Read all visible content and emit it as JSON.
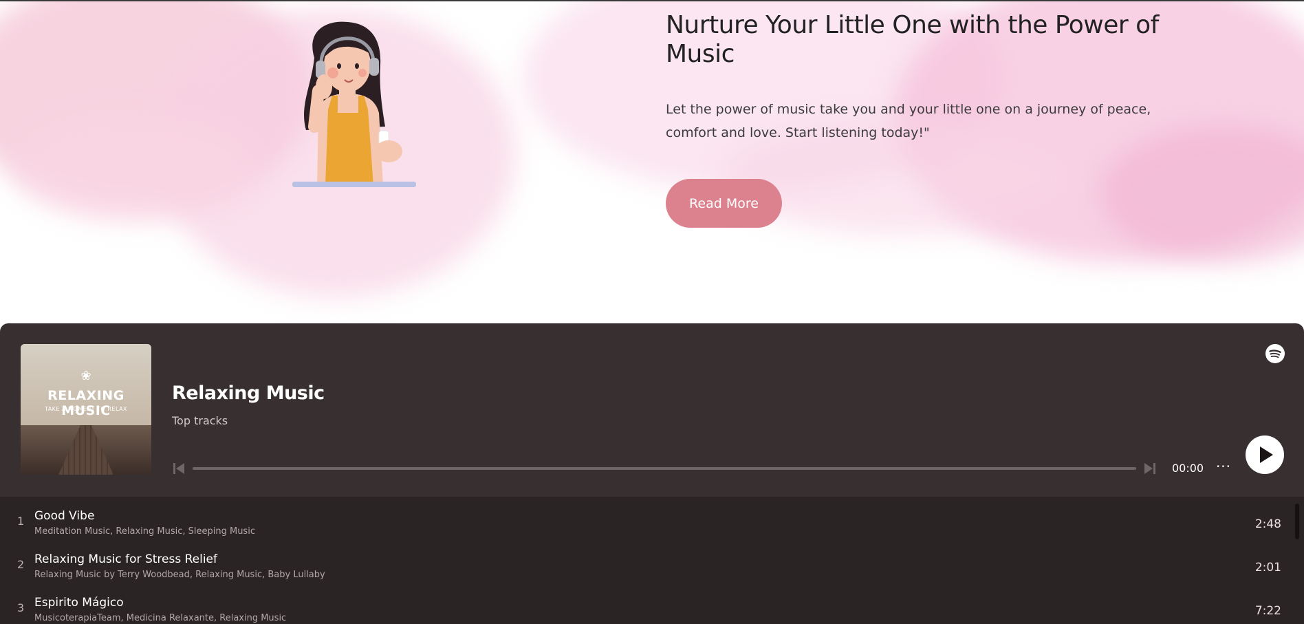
{
  "hero": {
    "title": "Nurture Your Little One with the Power of Music",
    "text": "Let the power of music take you and your little one on a journey of peace, comfort and love. Start listening today!\"",
    "button_label": "Read More"
  },
  "player": {
    "cover": {
      "title": "RELAXING MUSIC",
      "subtitle": "TAKE A MOMENT TO RELAX"
    },
    "title": "Relaxing Music",
    "subtitle": "Top tracks",
    "time": "00:00",
    "progress": 0,
    "more_label": "···",
    "tracks": [
      {
        "number": "1",
        "name": "Good Vibe",
        "artists": "Meditation Music, Relaxing Music, Sleeping Music",
        "duration": "2:48"
      },
      {
        "number": "2",
        "name": "Relaxing Music for Stress Relief",
        "artists": "Relaxing Music by Terry Woodbead, Relaxing Music, Baby Lullaby",
        "duration": "2:01"
      },
      {
        "number": "3",
        "name": "Espirito Mágico",
        "artists": "MusicoterapiaTeam, Medicina Relaxante, Relaxing Music",
        "duration": "7:22"
      }
    ]
  },
  "colors": {
    "accent_button": "#dc828e",
    "player_bg": "#382f30",
    "tracklist_bg": "#2b2425"
  },
  "icons": [
    "headphones-woman-illustration",
    "spotify-icon",
    "skip-back-icon",
    "skip-forward-icon",
    "more-icon",
    "play-icon",
    "lotus-icon"
  ]
}
